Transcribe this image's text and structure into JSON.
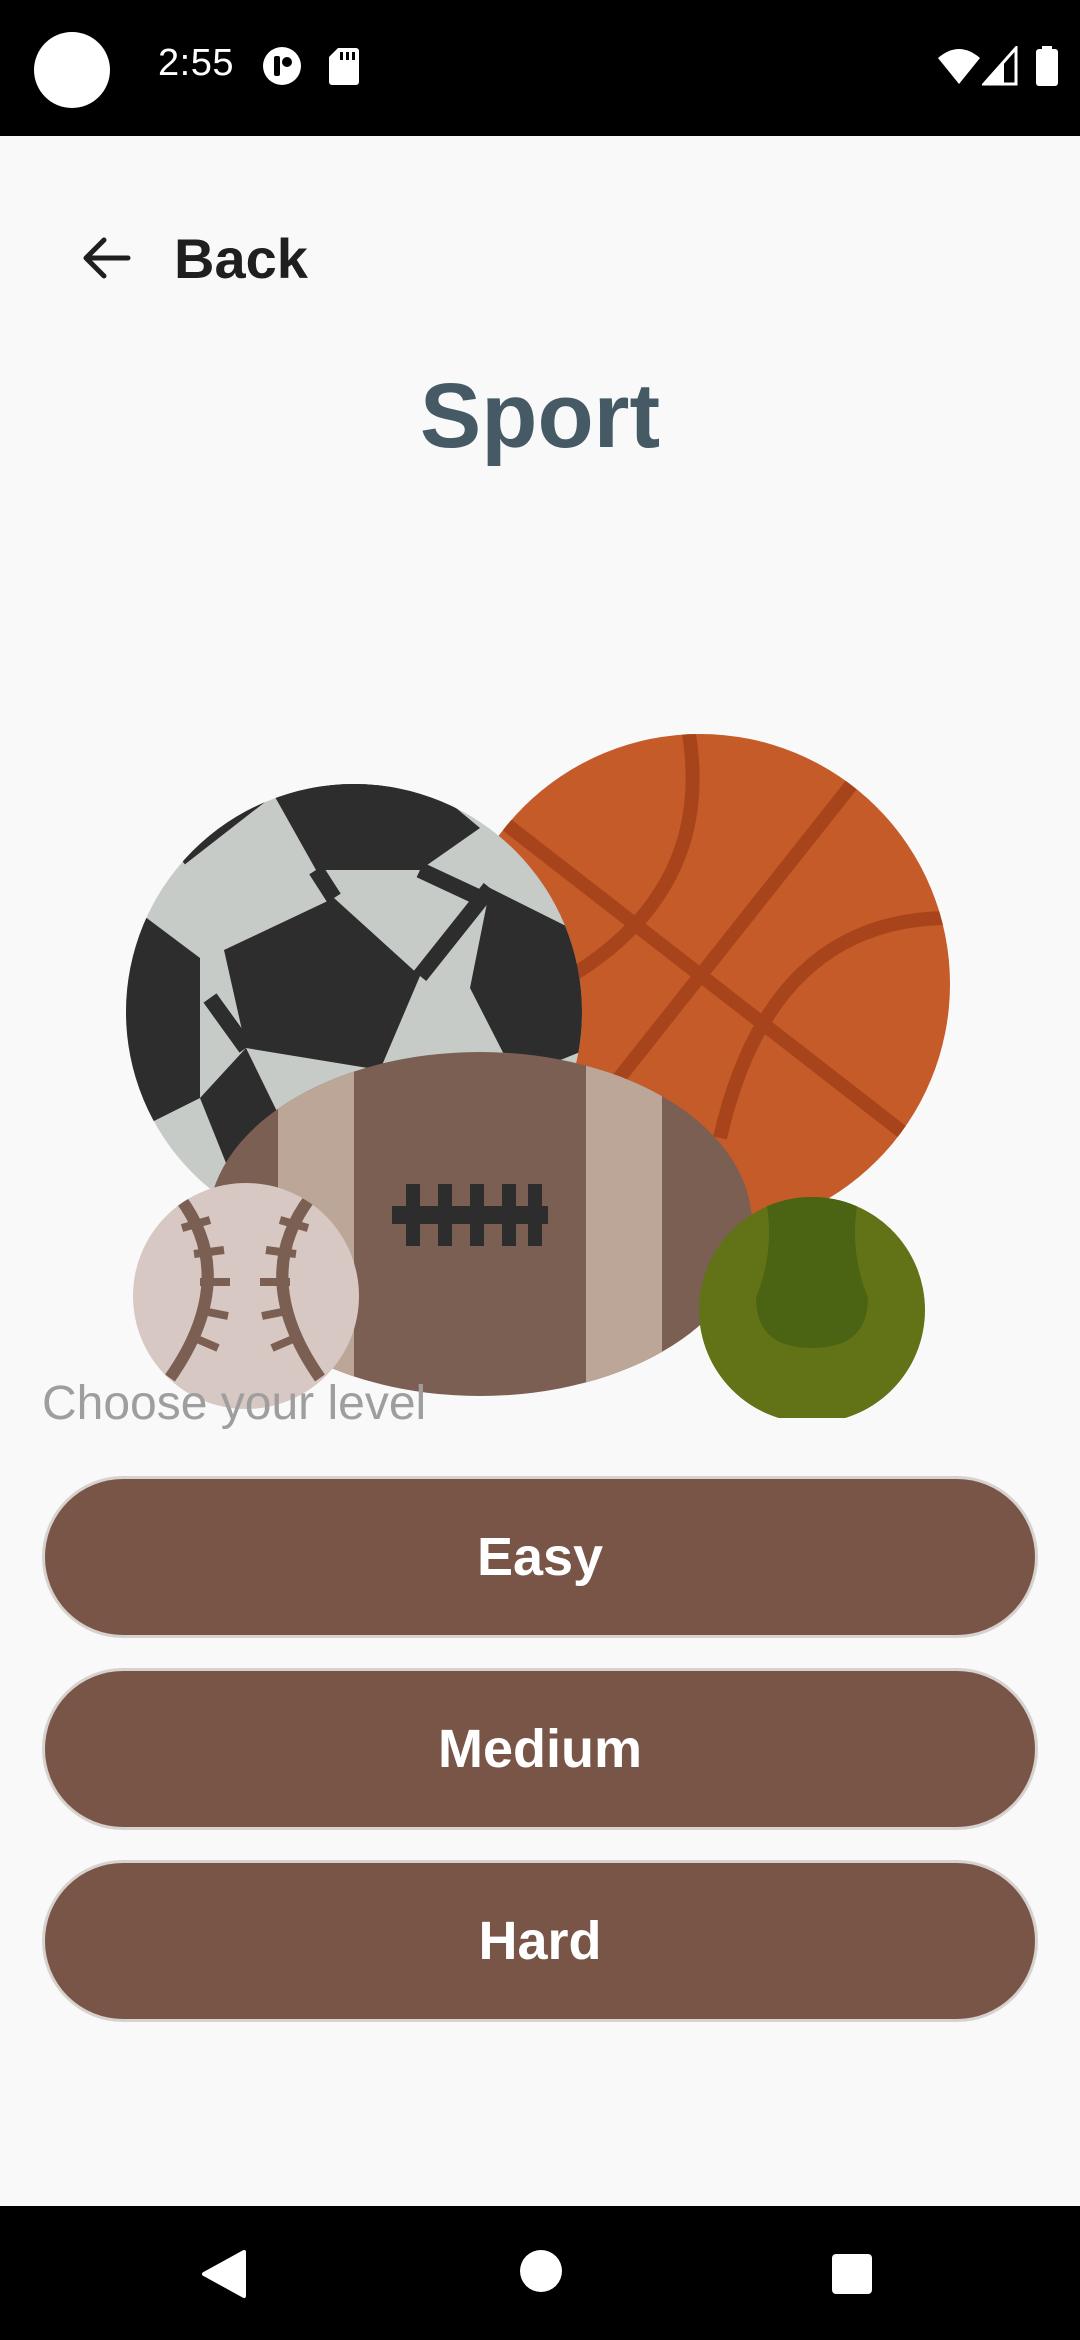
{
  "status_bar": {
    "time": "2:55",
    "icons": [
      "camera-cutout",
      "notification-icon",
      "sd-card-icon",
      "wifi-icon",
      "signal-icon",
      "battery-icon"
    ]
  },
  "header": {
    "back_label": "Back",
    "back_icon": "arrow-left-icon"
  },
  "page": {
    "title": "Sport",
    "illustration": "sports-balls-illustration",
    "level_prompt": "Choose your level",
    "levels": [
      {
        "label": "Easy"
      },
      {
        "label": "Medium"
      },
      {
        "label": "Hard"
      }
    ]
  },
  "nav_bar": {
    "buttons": [
      "back-triangle-icon",
      "home-circle-icon",
      "recents-square-icon"
    ]
  },
  "colors": {
    "title": "#465a65",
    "button_fill": "#795548",
    "background": "#f9f9f9",
    "prompt_text": "#9e9e9e"
  }
}
